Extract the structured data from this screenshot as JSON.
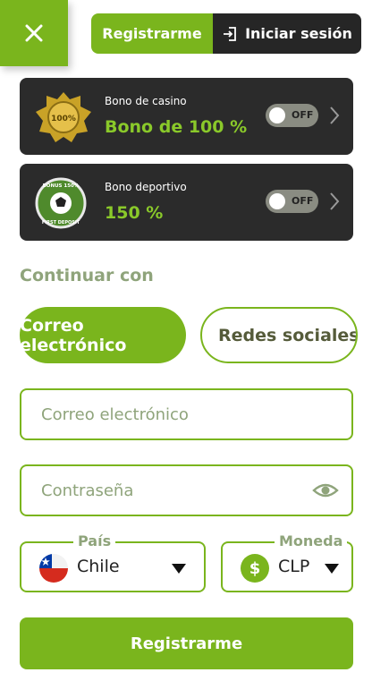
{
  "header": {
    "close_icon": "close-icon",
    "register_tab": "Registrarme",
    "login_tab": "Iniciar sesión",
    "login_icon": "login-icon"
  },
  "bonuses": [
    {
      "title": "Bono de casino",
      "value": "Bono de 100 %",
      "badge_text": "100%",
      "toggle": "OFF"
    },
    {
      "title": "Bono deportivo",
      "value": "150 %",
      "badge_text_top": "BONUS 150%",
      "badge_text_bottom": "FIRST DEPOSIT",
      "toggle": "OFF"
    }
  ],
  "continue_with": {
    "label": "Continuar con",
    "email_option": "Correo electrónico",
    "social_option": "Redes sociales"
  },
  "form": {
    "email_placeholder": "Correo electrónico",
    "password_placeholder": "Contraseña",
    "country_label": "País",
    "country_value": "Chile",
    "currency_label": "Moneda",
    "currency_value": "CLP",
    "currency_symbol": "$",
    "submit": "Registrarme"
  },
  "colors": {
    "accent": "#7ab51d",
    "dark": "#2b2b2b",
    "muted": "#8fa47b"
  }
}
